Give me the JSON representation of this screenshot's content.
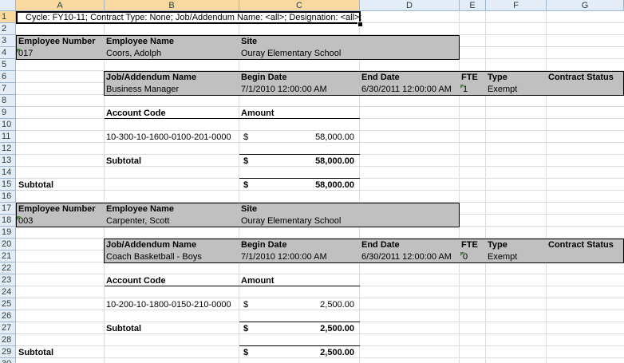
{
  "columns": [
    "A",
    "B",
    "C",
    "D",
    "E",
    "F",
    "G"
  ],
  "rows": [
    "1",
    "2",
    "3",
    "4",
    "5",
    "6",
    "7",
    "8",
    "9",
    "10",
    "11",
    "12",
    "13",
    "14",
    "15",
    "16",
    "17",
    "18",
    "19",
    "20",
    "21",
    "22",
    "23",
    "24",
    "25",
    "26",
    "27",
    "28",
    "29",
    "30"
  ],
  "a1_text": "Cycle: FY10-11; Contract Type: None; Job/Addendum Name: <all>; Designation: <all>;",
  "headers": {
    "employee_number": "Employee Number",
    "employee_name": "Employee Name",
    "site": "Site",
    "job_name": "Job/Addendum Name",
    "begin_date": "Begin Date",
    "end_date": "End Date",
    "fte": "FTE",
    "type": "Type",
    "contract_status": "Contract Status",
    "account_code": "Account Code",
    "amount": "Amount",
    "subtotal": "Subtotal",
    "currency": "$"
  },
  "records": [
    {
      "employee_number": "017",
      "employee_name": "Coors, Adolph",
      "site": "Ouray Elementary School",
      "job_name": "Business Manager",
      "begin_date": "7/1/2010 12:00:00 AM",
      "end_date": "6/30/2011 12:00:00 AM",
      "fte": "1",
      "type": "Exempt",
      "account_code": "10-300-10-1600-0100-201-0000",
      "amount": "58,000.00",
      "subtotal": "58,000.00",
      "grand_subtotal": "58,000.00"
    },
    {
      "employee_number": "003",
      "employee_name": "Carpenter, Scott",
      "site": "Ouray Elementary School",
      "job_name": "Coach Basketball - Boys",
      "begin_date": "7/1/2010 12:00:00 AM",
      "end_date": "6/30/2011 12:00:00 AM",
      "fte": "0",
      "type": "Exempt",
      "account_code": "10-200-10-1800-0150-210-0000",
      "amount": "2,500.00",
      "subtotal": "2,500.00",
      "grand_subtotal": "2,500.00"
    }
  ]
}
